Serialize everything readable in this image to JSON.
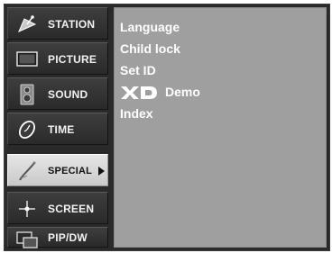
{
  "sidebar": {
    "items": [
      {
        "label": "STATION",
        "icon": "satellite-dish-icon"
      },
      {
        "label": "PICTURE",
        "icon": "monitor-icon"
      },
      {
        "label": "SOUND",
        "icon": "speaker-icon"
      },
      {
        "label": "TIME",
        "icon": "clock-icon"
      },
      {
        "label": "SPECIAL",
        "icon": "wand-icon",
        "selected": true
      },
      {
        "label": "SCREEN",
        "icon": "crosshair-icon"
      },
      {
        "label": "PIP/DW",
        "icon": "pip-windows-icon"
      }
    ]
  },
  "submenu": {
    "items": [
      {
        "label": "Language"
      },
      {
        "label": "Child lock"
      },
      {
        "label": "Set ID"
      },
      {
        "label": "Demo",
        "logo": "XD"
      },
      {
        "label": "Index"
      }
    ]
  },
  "colors": {
    "panel_bg": "#2a2a2a",
    "content_bg": "#9f9f9f",
    "selected_bg": "#d8d8d8",
    "text": "#ffffff"
  }
}
